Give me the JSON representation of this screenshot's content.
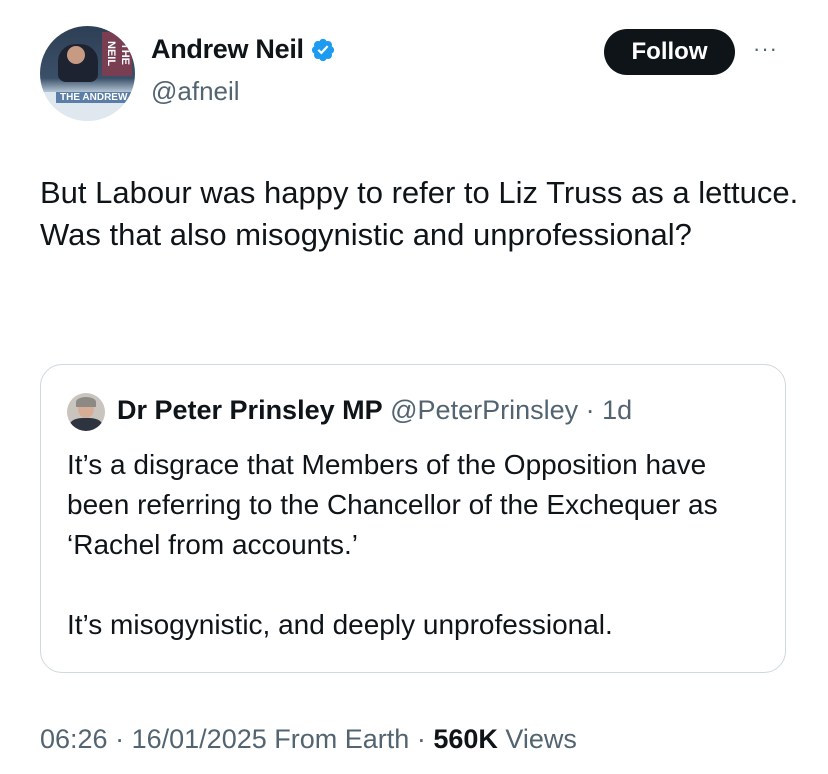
{
  "author": {
    "name": "Andrew Neil",
    "handle": "@afneil",
    "avatar_logo_top": "THE NEIL",
    "avatar_logo_bottom": "THE ANDREW"
  },
  "follow_label": "Follow",
  "more_label": "···",
  "tweet": {
    "text": "But Labour was happy to refer to Liz Truss as a lettuce. Was that also misogynistic and unprofessional?"
  },
  "quoted": {
    "name": "Dr Peter Prinsley MP",
    "handle": "@PeterPrinsley",
    "separator": "·",
    "age": "1d",
    "paragraph1": "It’s a disgrace that Members of the Opposition have been referring to the Chancellor of the Exchequer as ‘Rachel from accounts.’",
    "paragraph2": "It’s misogynistic, and deeply unprofessional."
  },
  "footer": {
    "time": "06:26",
    "sep1": "·",
    "date": "16/01/2025",
    "source": "From Earth",
    "sep2": "·",
    "views_count": "560K",
    "views_label": "Views"
  },
  "colors": {
    "verified_badge": "#1d9bf0",
    "follow_bg": "#0f1419",
    "secondary_text": "#536471",
    "border": "#cfd9de"
  }
}
